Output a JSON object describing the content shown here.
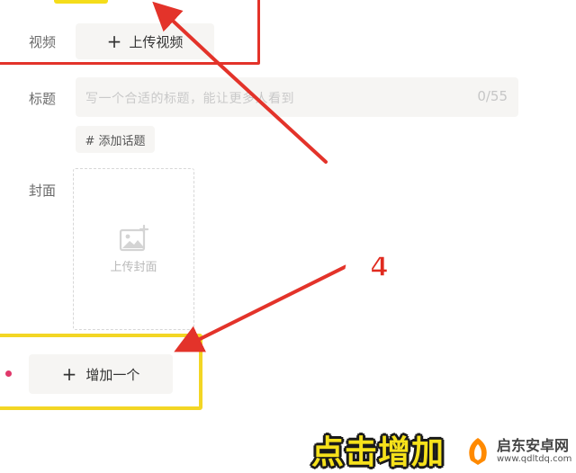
{
  "form": {
    "video_label": "视频",
    "upload_video_label": "上传视频",
    "title_label": "标题",
    "title_placeholder": "写一个合适的标题，能让更多人看到",
    "title_counter": "0/55",
    "add_topic_label": "# 添加话题",
    "cover_label": "封面",
    "upload_cover_label": "上传封面",
    "add_one_label": "增加一个"
  },
  "annotations": {
    "step_label": "第4步",
    "caption": "点击增加",
    "arrow_color": "#e3332a",
    "highlight_color": "#f3d624"
  },
  "watermark": {
    "name": "启东安卓网",
    "url": "www.qdltdq.com"
  }
}
